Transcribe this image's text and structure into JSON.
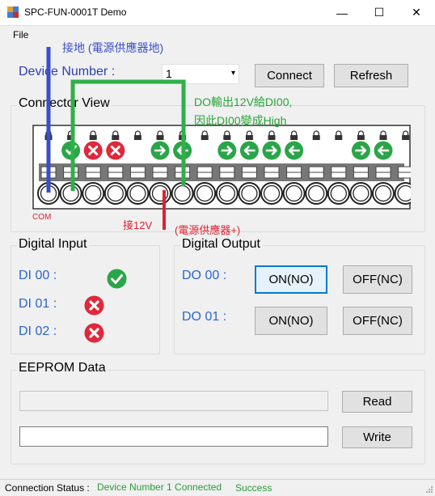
{
  "window": {
    "title": "SPC-FUN-0001T Demo",
    "minimize": "—",
    "maximize": "☐",
    "close": "✕"
  },
  "menu": {
    "file": "File"
  },
  "device": {
    "label": "Device Number :",
    "value": "1",
    "dropdown_arrow": "▾"
  },
  "buttons": {
    "connect": "Connect",
    "refresh": "Refresh",
    "read": "Read",
    "write": "Write"
  },
  "connector": {
    "title": "Connector View",
    "pin_states": [
      "none",
      "ok",
      "err",
      "err",
      "none",
      "arrow_right",
      "arrow_left",
      "none",
      "arrow_right",
      "arrow_left",
      "arrow_right",
      "arrow_left",
      "none",
      "none",
      "arrow_right",
      "arrow_left",
      "none"
    ],
    "com_label": "COM"
  },
  "annotations": {
    "ground": "接地 (電源供應器地)",
    "do_note_line1": "DO輸出12V給DI00,",
    "do_note_line2": "因此DI00變成High",
    "v12": "接12V",
    "v12_psu": "(電源供應器+)",
    "colors": {
      "blue": "#3b4ec8",
      "green": "#2fb048",
      "red": "#e02030",
      "green_text": "#27a336"
    }
  },
  "digital_input": {
    "title": "Digital Input",
    "items": [
      {
        "label": "DI 00 :",
        "state": "ok"
      },
      {
        "label": "DI 01 :",
        "state": "err"
      },
      {
        "label": "DI 02 :",
        "state": "err"
      }
    ]
  },
  "digital_output": {
    "title": "Digital Output",
    "items": [
      {
        "label": "DO 00 :",
        "on": "ON(NO)",
        "off": "OFF(NC)"
      },
      {
        "label": "DO 01 :",
        "on": "ON(NO)",
        "off": "OFF(NC)"
      }
    ]
  },
  "eeprom": {
    "title": "EEPROM Data",
    "read_value": "",
    "write_value": ""
  },
  "status": {
    "label": "Connection Status :",
    "device": "Device Number 1 Connected",
    "result": "Success"
  },
  "icons": {
    "ok": "check-circle-icon",
    "err": "x-circle-icon",
    "arrow_right": "arrow-right-circle-icon",
    "arrow_left": "arrow-left-circle-icon",
    "lock": "lock-icon"
  }
}
